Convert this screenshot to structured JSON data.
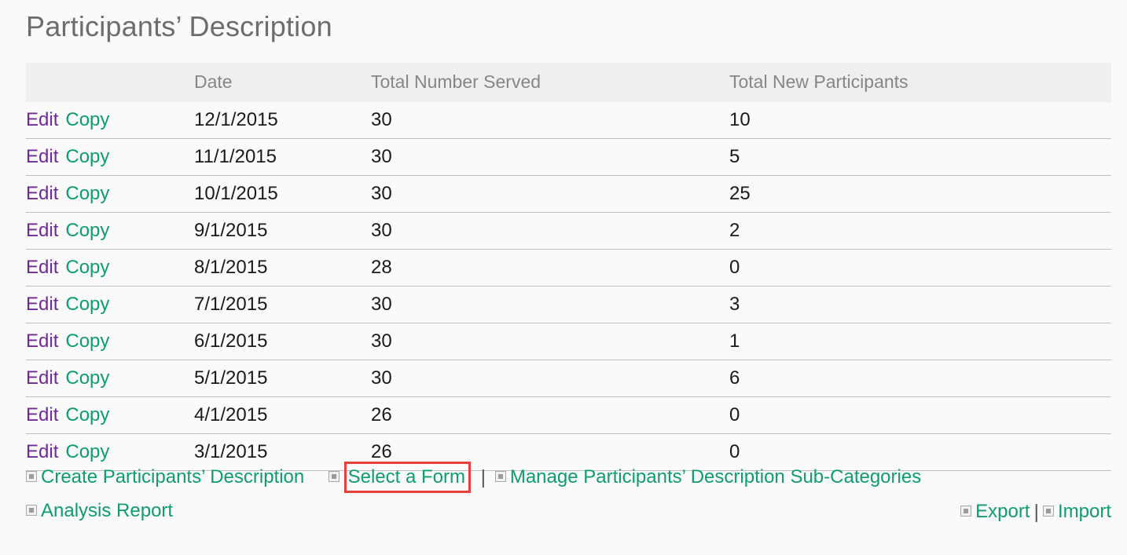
{
  "page": {
    "title": "Participants’ Description",
    "background_color": "#fafafa"
  },
  "colors": {
    "link_green": "#0e9c70",
    "link_visited_purple": "#6f2a94",
    "header_gray": "#868686",
    "title_gray": "#6d6d6d",
    "highlight_red": "#e8403a",
    "header_row_bg": "#efefef",
    "row_border": "#bfbfbf"
  },
  "table": {
    "name": "participants-description-grid",
    "columns": [
      {
        "key": "actions",
        "label": ""
      },
      {
        "key": "date",
        "label": "Date"
      },
      {
        "key": "served",
        "label": "Total Number Served"
      },
      {
        "key": "new",
        "label": "Total New Participants"
      }
    ],
    "row_actions": {
      "edit": "Edit",
      "copy": "Copy"
    },
    "rows": [
      {
        "date": "12/1/2015",
        "served": "30",
        "new": "10"
      },
      {
        "date": "11/1/2015",
        "served": "30",
        "new": "5"
      },
      {
        "date": "10/1/2015",
        "served": "30",
        "new": "25"
      },
      {
        "date": "9/1/2015",
        "served": "30",
        "new": "2"
      },
      {
        "date": "8/1/2015",
        "served": "28",
        "new": "0"
      },
      {
        "date": "7/1/2015",
        "served": "30",
        "new": "3"
      },
      {
        "date": "6/1/2015",
        "served": "30",
        "new": "1"
      },
      {
        "date": "5/1/2015",
        "served": "30",
        "new": "6"
      },
      {
        "date": "4/1/2015",
        "served": "26",
        "new": "0"
      },
      {
        "date": "3/1/2015",
        "served": "26",
        "new": "0"
      }
    ]
  },
  "toolbar": {
    "create_label": "Create Participants’ Description",
    "select_form_label": "Select a Form",
    "manage_subcategories_label": "Manage Participants’ Description Sub-Categories",
    "analysis_report_label": "Analysis Report",
    "export_label": "Export",
    "import_label": "Import",
    "separator": "|",
    "icon": "bullet-square-icon"
  }
}
